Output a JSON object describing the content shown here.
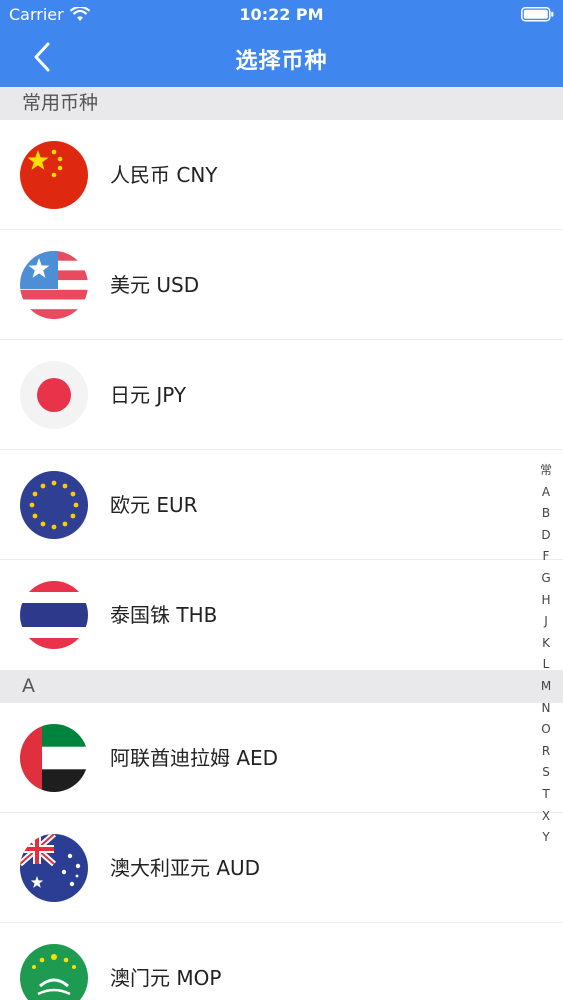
{
  "status_bar": {
    "carrier": "Carrier",
    "time": "10:22 PM"
  },
  "nav": {
    "title": "选择币种",
    "back_icon": "chevron-left-icon"
  },
  "sections": [
    {
      "title": "常用币种",
      "items": [
        {
          "label": "人民币 CNY",
          "flag": "china-flag-icon"
        },
        {
          "label": "美元 USD",
          "flag": "usa-flag-icon"
        },
        {
          "label": "日元 JPY",
          "flag": "japan-flag-icon"
        },
        {
          "label": "欧元 EUR",
          "flag": "eu-flag-icon"
        },
        {
          "label": "泰国铢 THB",
          "flag": "thailand-flag-icon"
        }
      ]
    },
    {
      "title": "A",
      "items": [
        {
          "label": "阿联酋迪拉姆 AED",
          "flag": "uae-flag-icon"
        },
        {
          "label": "澳大利亚元 AUD",
          "flag": "australia-flag-icon"
        },
        {
          "label": "澳门元 MOP",
          "flag": "macau-flag-icon"
        }
      ]
    }
  ],
  "index_letters": [
    "常",
    "A",
    "B",
    "D",
    "F",
    "G",
    "H",
    "J",
    "K",
    "L",
    "M",
    "N",
    "O",
    "R",
    "S",
    "T",
    "X",
    "Y"
  ],
  "colors": {
    "header": "#3f86ef",
    "section_bg": "#e9e9eb"
  }
}
